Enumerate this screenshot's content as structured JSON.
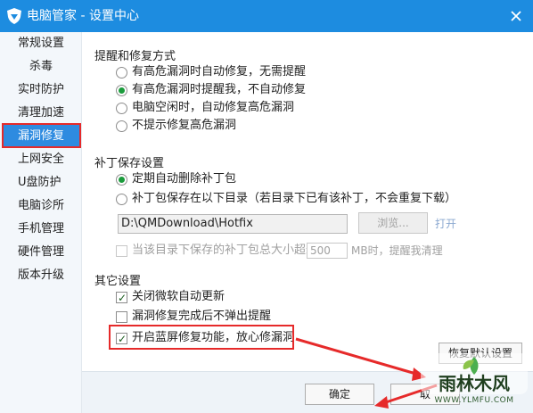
{
  "window": {
    "title": "电脑管家 - 设置中心",
    "accent": "#1d8ce0"
  },
  "sidebar": {
    "items": [
      {
        "label": "常规设置"
      },
      {
        "label": "杀毒"
      },
      {
        "label": "实时防护"
      },
      {
        "label": "清理加速"
      },
      {
        "label": "漏洞修复",
        "active": true
      },
      {
        "label": "上网安全"
      },
      {
        "label": "U盘防护"
      },
      {
        "label": "电脑诊所"
      },
      {
        "label": "手机管理"
      },
      {
        "label": "硬件管理"
      },
      {
        "label": "版本升级"
      }
    ]
  },
  "repair_mode": {
    "title": "提醒和修复方式",
    "options": [
      {
        "label": "有高危漏洞时自动修复，无需提醒",
        "selected": false
      },
      {
        "label": "有高危漏洞时提醒我，不自动修复",
        "selected": true
      },
      {
        "label": "电脑空闲时，自动修复高危漏洞",
        "selected": false
      },
      {
        "label": "不提示修复高危漏洞",
        "selected": false
      }
    ]
  },
  "patch_storage": {
    "title": "补丁保存设置",
    "options": [
      {
        "label": "定期自动删除补丁包",
        "selected": true
      },
      {
        "label": "补丁包保存在以下目录（若目录下已有该补丁，不会重复下载）",
        "selected": false
      }
    ],
    "path_value": "D:\\QMDownload\\Hotfix",
    "browse_label": "浏览...",
    "open_label": "打开",
    "size_limit": {
      "prefix": "当该目录下保存的补丁包总大小超过",
      "value": "500",
      "suffix": "MB时，提醒我清理",
      "checked": false
    }
  },
  "other": {
    "title": "其它设置",
    "options": [
      {
        "label": "关闭微软自动更新",
        "checked": true
      },
      {
        "label": "漏洞修复完成后不弹出提醒",
        "checked": false
      },
      {
        "label": "开启蓝屏修复功能，放心修漏洞",
        "checked": true
      }
    ]
  },
  "buttons": {
    "restore_default": "恢复默认设置",
    "ok": "确定",
    "cancel": "取"
  },
  "watermark": {
    "brand": "雨林木风",
    "url": "WWW.YLMFU.COM"
  },
  "annotation_color": "#e62a2a"
}
